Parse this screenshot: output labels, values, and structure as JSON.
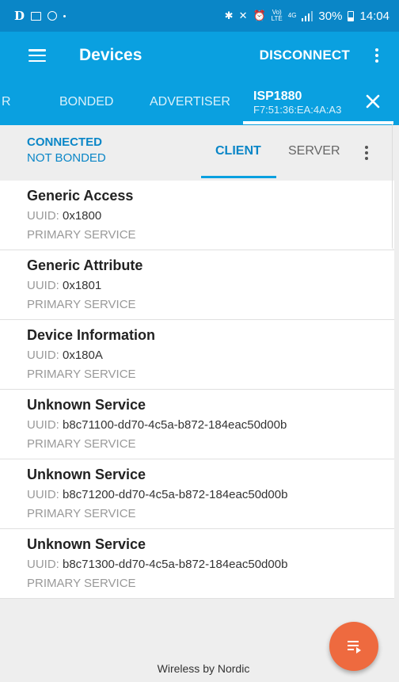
{
  "status_bar": {
    "carrier_glyph": "D",
    "battery": "30%",
    "time": "14:04",
    "network": "4G",
    "lte": "LTE"
  },
  "app_bar": {
    "title": "Devices",
    "action": "DISCONNECT"
  },
  "tabs": [
    {
      "label": "R"
    },
    {
      "label": "BONDED"
    },
    {
      "label": "ADVERTISER"
    }
  ],
  "device_tab": {
    "name": "ISP1880",
    "mac": "F7:51:36:EA:4A:A3"
  },
  "connection": {
    "state": "CONNECTED",
    "bond": "NOT BONDED"
  },
  "subtabs": {
    "client": "CLIENT",
    "server": "SERVER"
  },
  "uuid_label": "UUID: ",
  "services": [
    {
      "name": "Generic Access",
      "uuid": "0x1800",
      "type": "PRIMARY SERVICE"
    },
    {
      "name": "Generic Attribute",
      "uuid": "0x1801",
      "type": "PRIMARY SERVICE"
    },
    {
      "name": "Device Information",
      "uuid": "0x180A",
      "type": "PRIMARY SERVICE"
    },
    {
      "name": "Unknown Service",
      "uuid": "b8c71100-dd70-4c5a-b872-184eac50d00b",
      "type": "PRIMARY SERVICE"
    },
    {
      "name": "Unknown Service",
      "uuid": "b8c71200-dd70-4c5a-b872-184eac50d00b",
      "type": "PRIMARY SERVICE"
    },
    {
      "name": "Unknown Service",
      "uuid": "b8c71300-dd70-4c5a-b872-184eac50d00b",
      "type": "PRIMARY SERVICE"
    }
  ],
  "footer": "Wireless by Nordic",
  "icons": {
    "menu": "hamburger-icon",
    "overflow": "overflow-menu-icon",
    "close": "close-icon",
    "fab": "log-list-icon"
  },
  "colors": {
    "status_bar": "#0a86c7",
    "primary": "#0aa0e0",
    "accent": "#ee6a3f",
    "connected_text": "#0a86c7"
  }
}
